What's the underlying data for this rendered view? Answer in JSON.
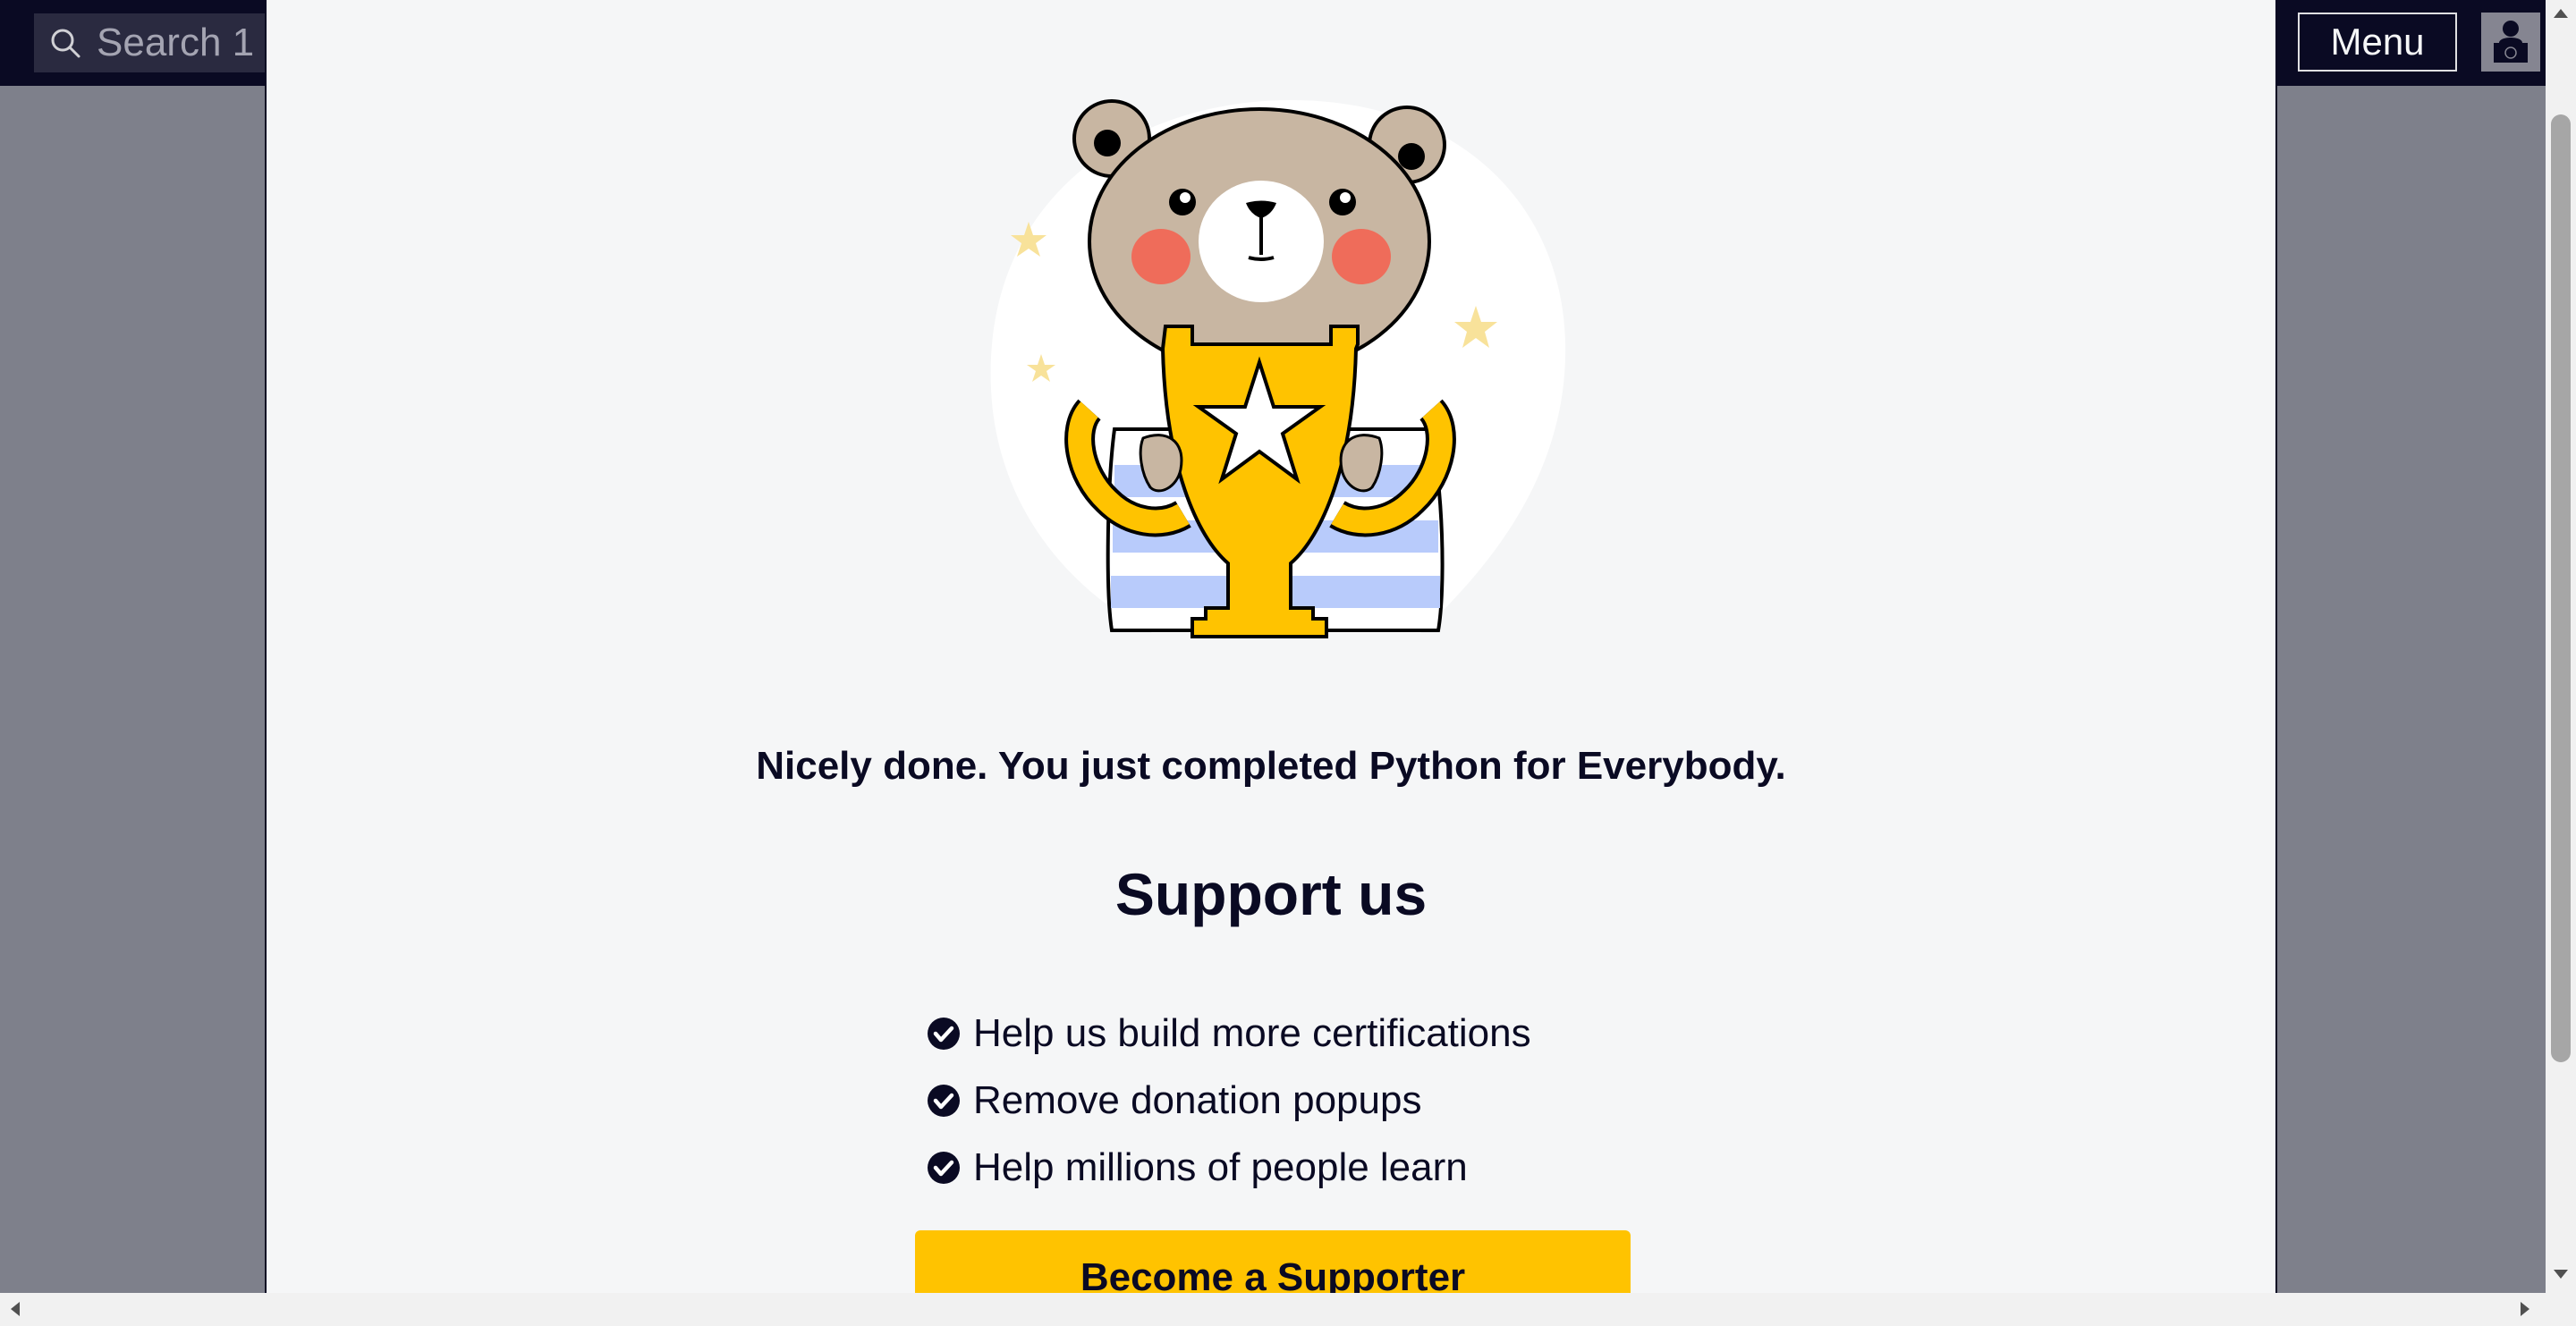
{
  "header": {
    "search_placeholder": "Search 1",
    "menu_label": "Menu"
  },
  "modal": {
    "completion_message": "Nicely done. You just completed Python for Everybody.",
    "heading": "Support us",
    "benefits": [
      "Help us build more certifications",
      "Remove donation popups",
      "Help millions of people learn"
    ],
    "cta_label": "Become a Supporter"
  },
  "colors": {
    "nav_bg": "#0a0a23",
    "modal_bg": "#f5f6f7",
    "cta_bg": "#ffc300",
    "overlay": "#7e808b"
  },
  "icons": [
    "search-icon",
    "avatar-icon",
    "bear-trophy-illustration",
    "check-circle-icon"
  ]
}
